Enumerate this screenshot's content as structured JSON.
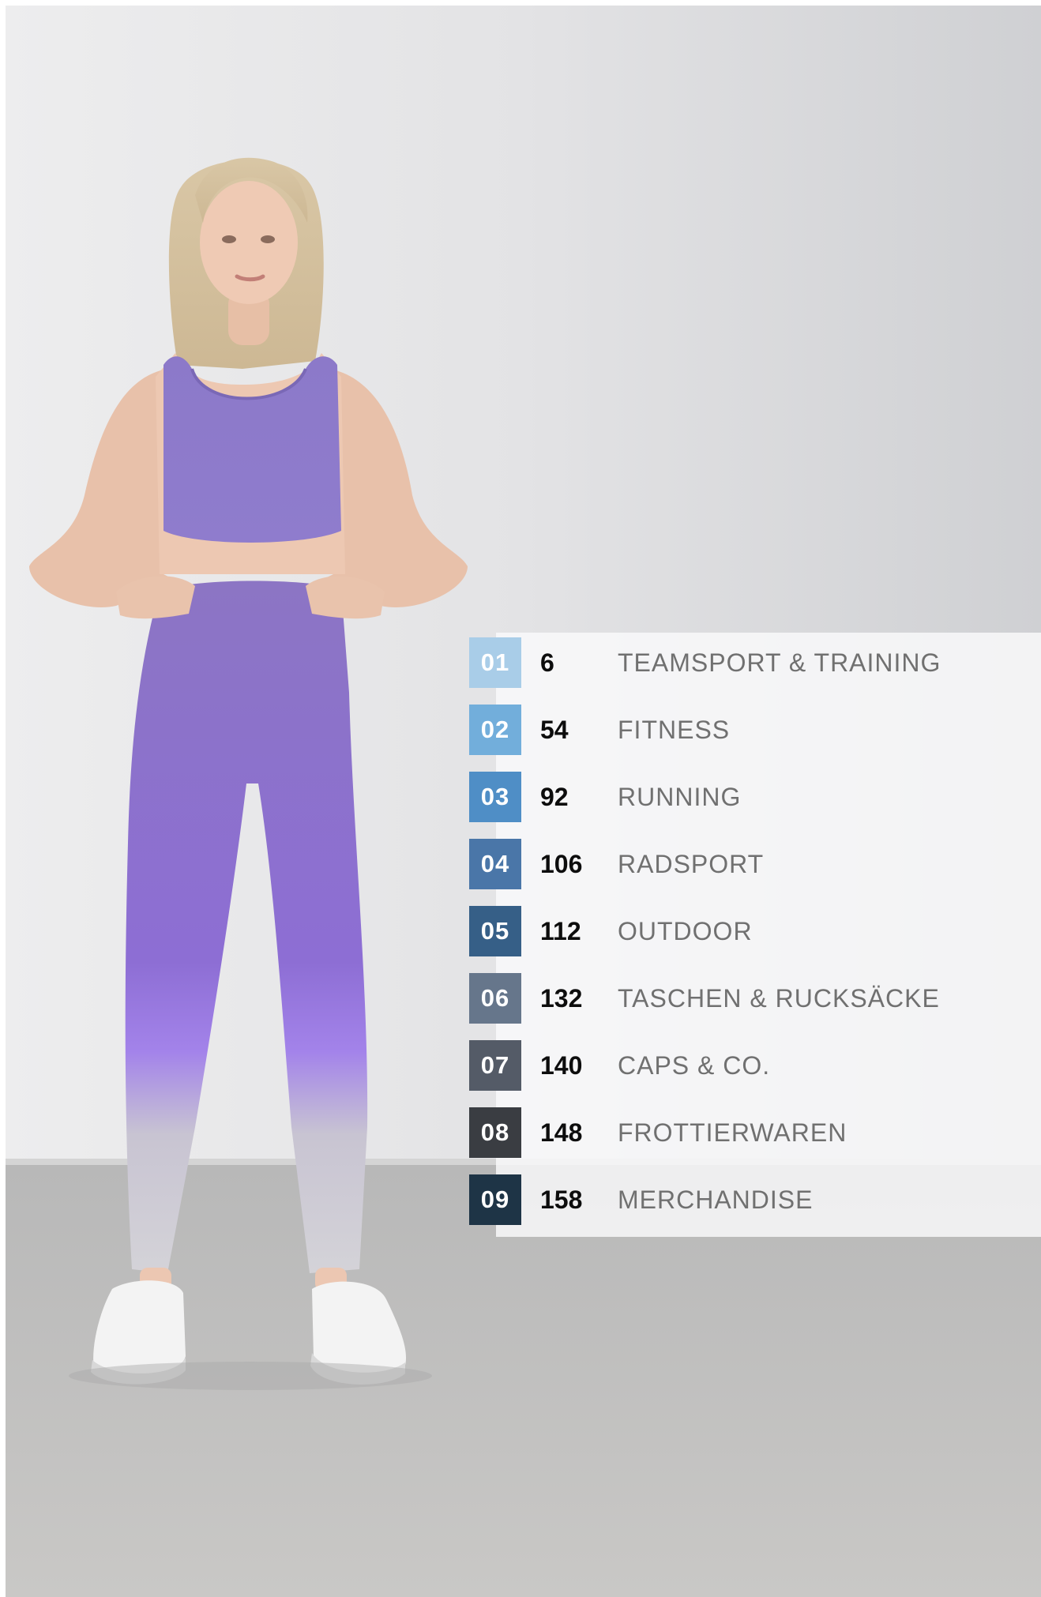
{
  "toc": {
    "items": [
      {
        "number": "01",
        "page": "6",
        "label": "TEAMSPORT & TRAINING",
        "color": "#a9cde8"
      },
      {
        "number": "02",
        "page": "54",
        "label": "FITNESS",
        "color": "#72aedb"
      },
      {
        "number": "03",
        "page": "92",
        "label": "RUNNING",
        "color": "#4f8ec6"
      },
      {
        "number": "04",
        "page": "106",
        "label": "RADSPORT",
        "color": "#4a76a8"
      },
      {
        "number": "05",
        "page": "112",
        "label": "OUTDOOR",
        "color": "#365f87"
      },
      {
        "number": "06",
        "page": "132",
        "label": "TASCHEN & RUCKSÄCKE",
        "color": "#66768b"
      },
      {
        "number": "07",
        "page": "140",
        "label": "CAPS & CO.",
        "color": "#545b67"
      },
      {
        "number": "08",
        "page": "148",
        "label": "FROTTIERWAREN",
        "color": "#3a3d42"
      },
      {
        "number": "09",
        "page": "158",
        "label": "MERCHANDISE",
        "color": "#1e3446"
      }
    ]
  }
}
